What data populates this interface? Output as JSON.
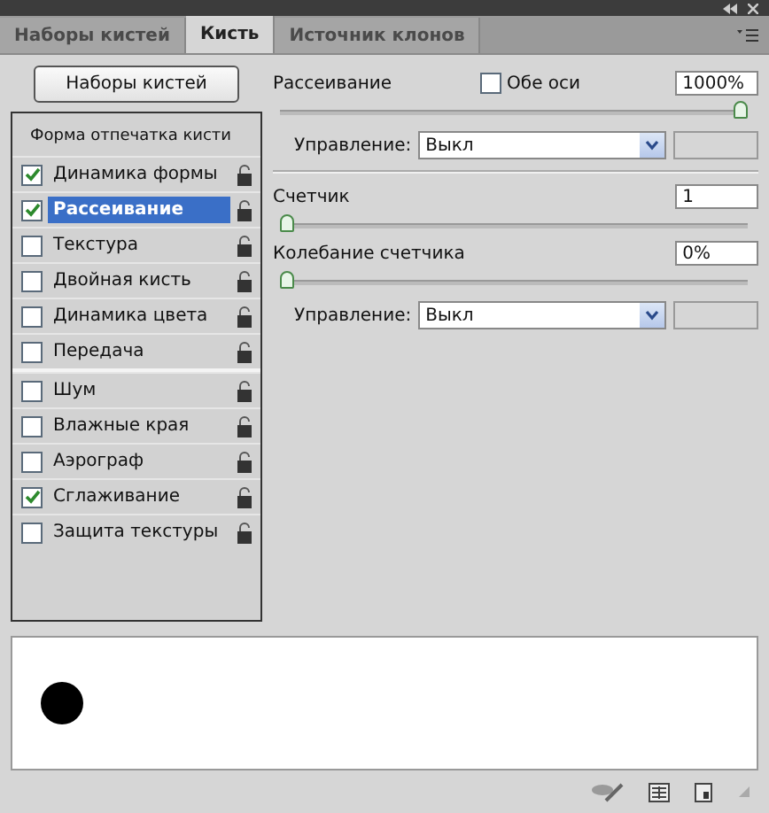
{
  "tabs": [
    {
      "label": "Наборы кистей",
      "selected": false
    },
    {
      "label": "Кисть",
      "selected": true
    },
    {
      "label": "Источник клонов",
      "selected": false
    }
  ],
  "presets_button": "Наборы кистей",
  "brush_list": {
    "header": "Форма отпечатка кисти",
    "items": [
      {
        "label": "Динамика формы",
        "checked": true,
        "selected": false
      },
      {
        "label": "Рассеивание",
        "checked": true,
        "selected": true
      },
      {
        "label": "Текстура",
        "checked": false,
        "selected": false
      },
      {
        "label": "Двойная кисть",
        "checked": false,
        "selected": false
      },
      {
        "label": "Динамика цвета",
        "checked": false,
        "selected": false
      },
      {
        "label": "Передача",
        "checked": false,
        "selected": false,
        "group_end": true
      },
      {
        "label": "Шум",
        "checked": false,
        "selected": false
      },
      {
        "label": "Влажные края",
        "checked": false,
        "selected": false
      },
      {
        "label": "Аэрограф",
        "checked": false,
        "selected": false
      },
      {
        "label": "Сглаживание",
        "checked": true,
        "selected": false
      },
      {
        "label": "Защита текстуры",
        "checked": false,
        "selected": false
      }
    ]
  },
  "settings": [
    {
      "kind": "slider",
      "label": "Рассеивание",
      "value": "1000%",
      "level": 1,
      "checkbox": {
        "label": "Обе оси",
        "checked": false
      }
    },
    {
      "kind": "control",
      "label": "Управление:",
      "value": "Выкл",
      "divider_after": true
    },
    {
      "kind": "slider",
      "label": "Счетчик",
      "value": "1",
      "level": 0
    },
    {
      "kind": "slider",
      "label": "Колебание счетчика",
      "value": "0%",
      "level": 0
    },
    {
      "kind": "control",
      "label": "Управление:",
      "value": "Выкл"
    }
  ]
}
